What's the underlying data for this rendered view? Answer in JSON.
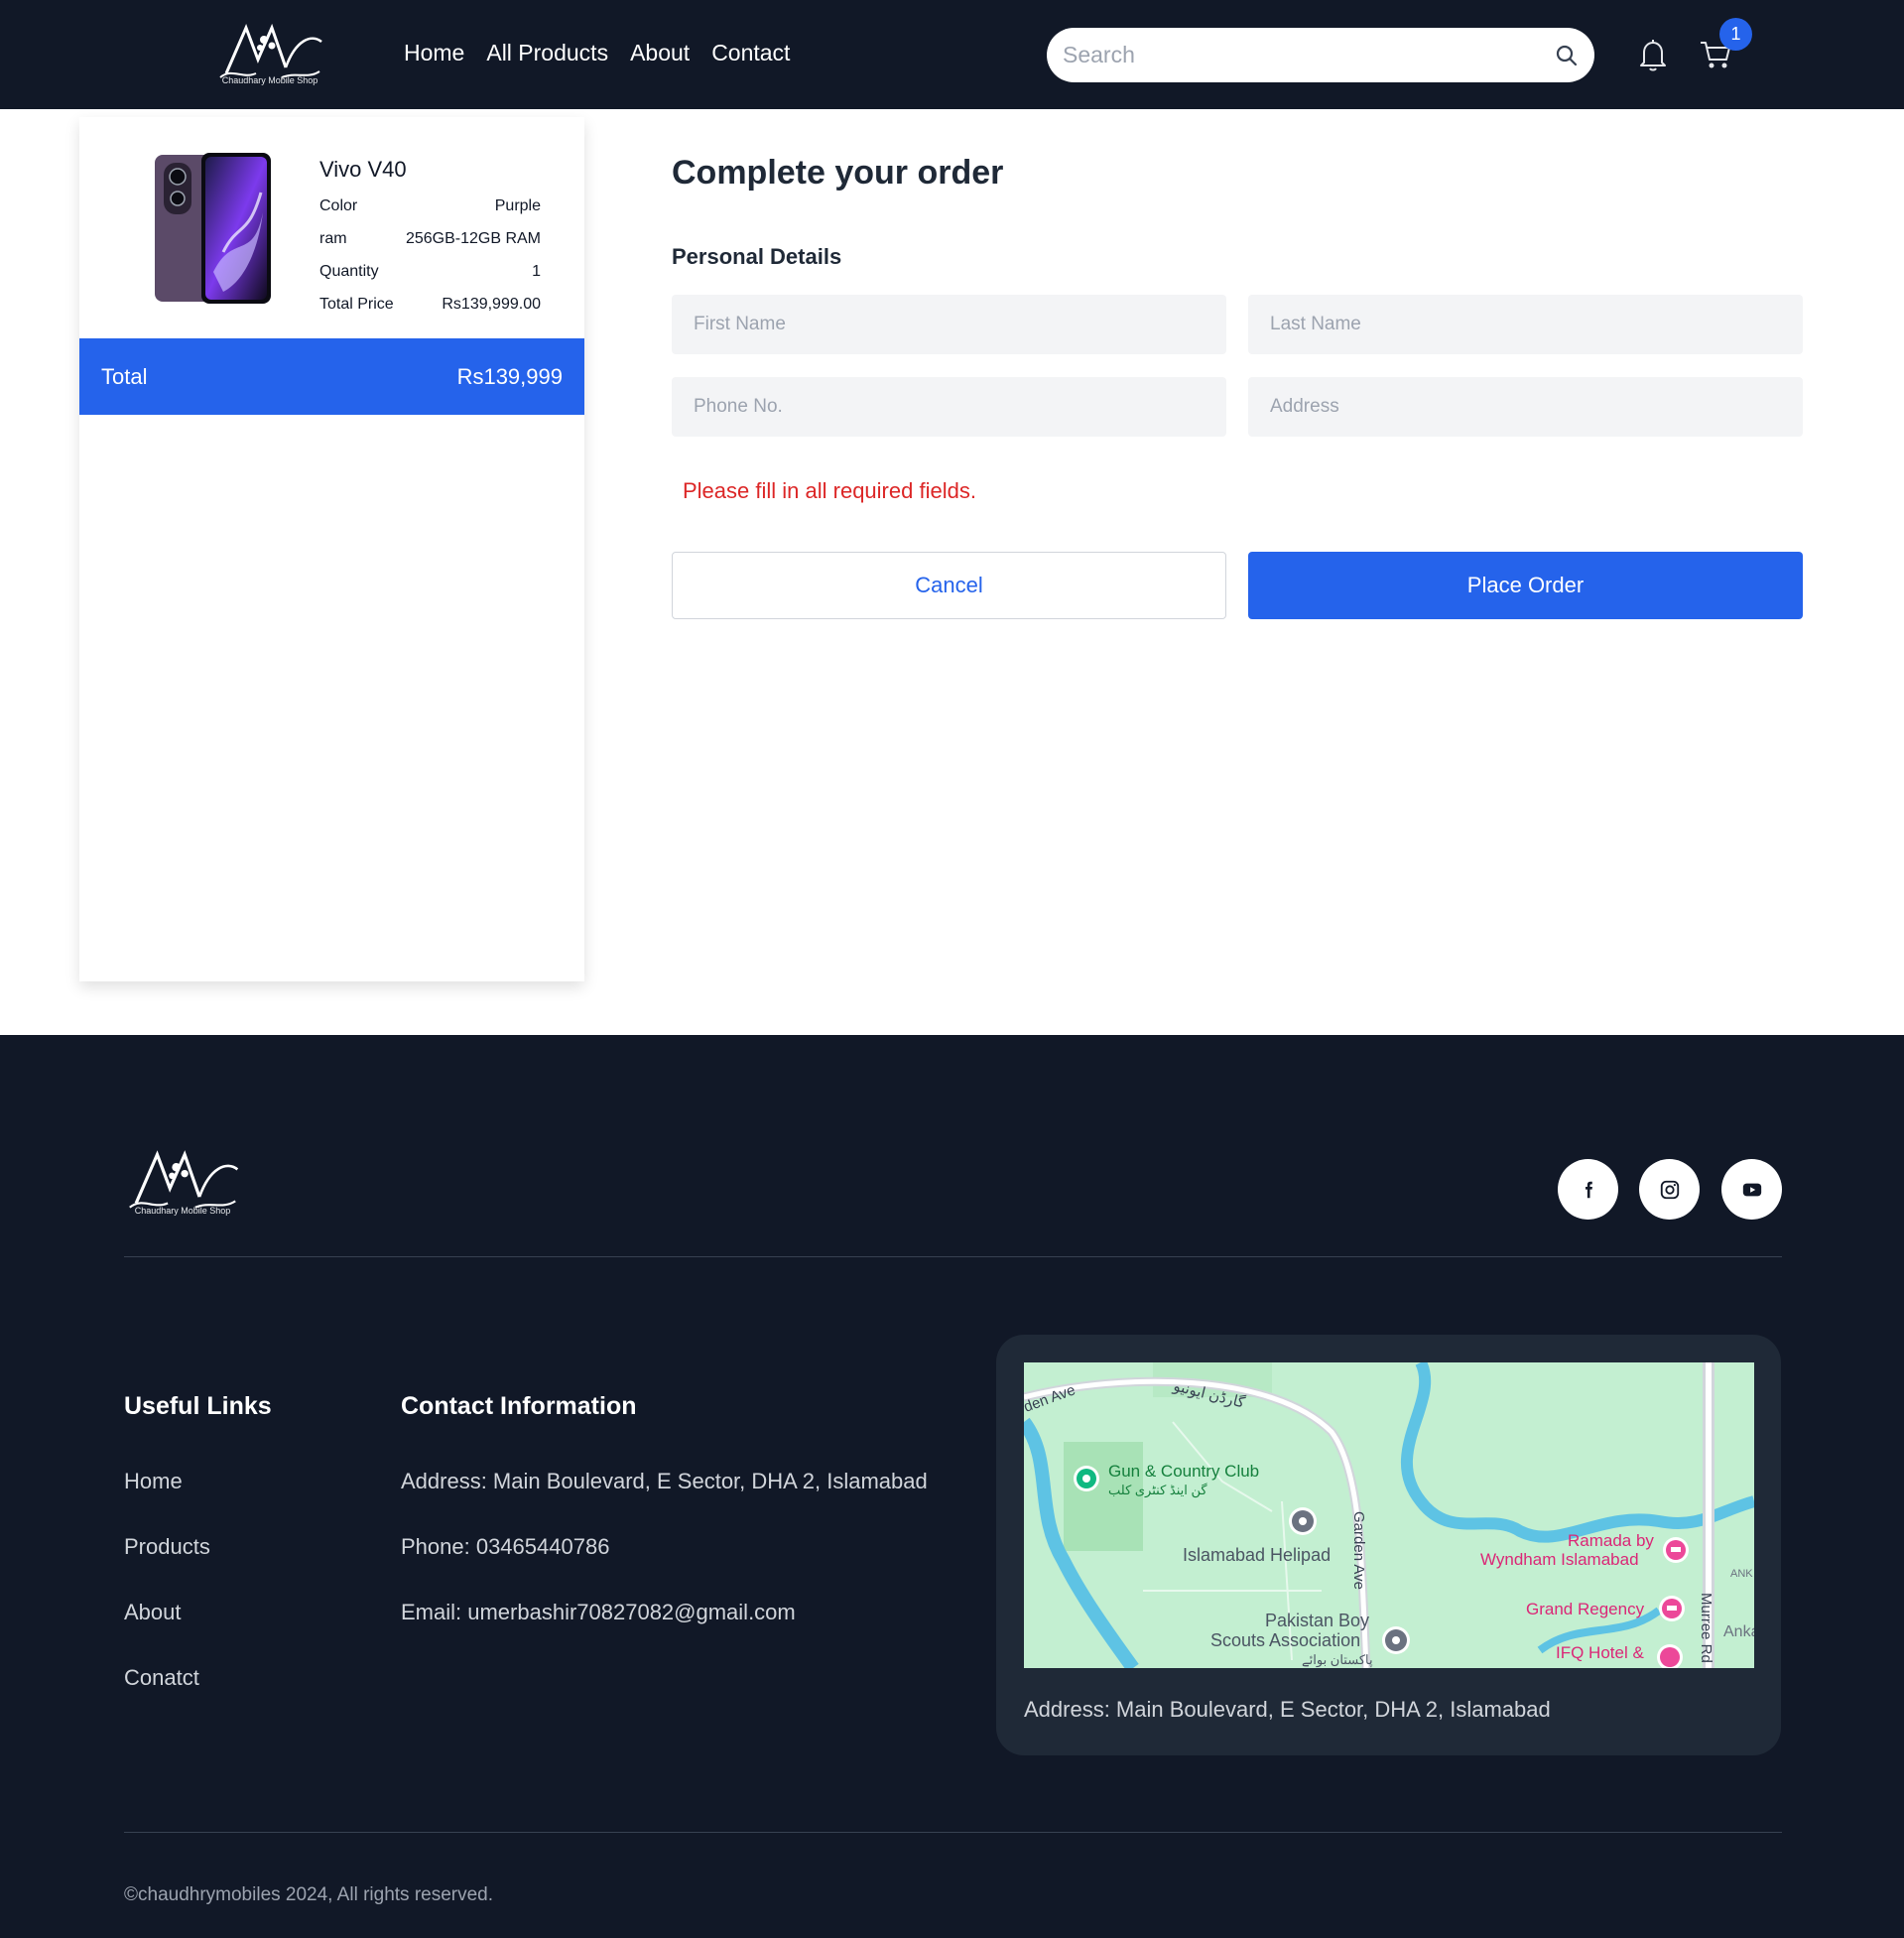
{
  "header": {
    "logo_text": "Chaudhary Mobile Shop",
    "nav": [
      "Home",
      "All Products",
      "About",
      "Contact"
    ],
    "search_placeholder": "Search",
    "cart_count": "1"
  },
  "summary": {
    "product_name": "Vivo V40",
    "details": [
      {
        "label": "Color",
        "value": "Purple"
      },
      {
        "label": "ram",
        "value": "256GB-12GB RAM"
      },
      {
        "label": "Quantity",
        "value": "1"
      },
      {
        "label": "Total Price",
        "value": "Rs139,999.00"
      }
    ],
    "total_label": "Total",
    "total_value": "Rs139,999"
  },
  "form": {
    "title": "Complete your order",
    "section": "Personal Details",
    "first_name_placeholder": "First Name",
    "last_name_placeholder": "Last Name",
    "phone_placeholder": "Phone No.",
    "address_placeholder": "Address",
    "error": "Please fill in all required fields.",
    "cancel_label": "Cancel",
    "place_order_label": "Place Order"
  },
  "footer": {
    "logo_text": "Chaudhary Mobile Shop",
    "social": [
      "facebook-icon",
      "instagram-icon",
      "youtube-icon"
    ],
    "useful_links_title": "Useful Links",
    "useful_links": [
      "Home",
      "Products",
      "About",
      "Conatct"
    ],
    "contact_title": "Contact Information",
    "contact": {
      "address": "Address: Main Boulevard, E Sector, DHA 2, Islamabad",
      "phone": "Phone: 03465440786",
      "email": "Email: umerbashir70827082@gmail.com"
    },
    "map": {
      "labels": {
        "gun_club": "Gun & Country Club",
        "gun_club_urdu": "گن اینڈ کنٹری کلب",
        "helipad": "Islamabad Helipad",
        "garden_ave": "Garden Ave",
        "garden_ave_left": "den Ave",
        "garden_ave_urdu": "گارڈن ایونیو",
        "ramada_1": "Ramada by",
        "ramada_2": "Wyndham Islamabad",
        "grand_regency": "Grand Regency",
        "ifq": "IFQ Hotel &",
        "scouts_1": "Pakistan Boy",
        "scouts_2": "Scouts Association",
        "scouts_urdu": "پاکستان بوائے",
        "murree_rd": "Murree Rd",
        "anka": "Anka",
        "ank": "ANK"
      }
    },
    "map_address": "Address: Main Boulevard, E Sector, DHA 2, Islamabad",
    "copyright": "©chaudhrymobiles 2024, All rights reserved."
  },
  "colors": {
    "header_bg": "#111827",
    "accent": "#2563eb",
    "error": "#dc2626",
    "footer_card": "#1f2937"
  }
}
